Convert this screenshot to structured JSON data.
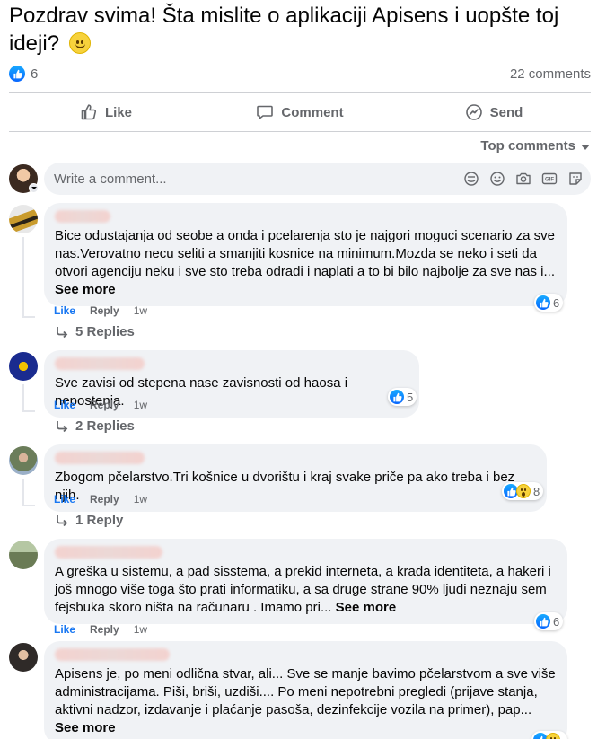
{
  "post": {
    "title": "Pozdrav svima! Šta mislite o aplikaciji Apisens i uopšte toj ideji?",
    "title_emoji": "slightly-smiling-face-icon",
    "like_count": "6",
    "comments_label": "22 comments"
  },
  "actions": {
    "like": "Like",
    "comment": "Comment",
    "send": "Send"
  },
  "sort": {
    "label": "Top comments"
  },
  "composer": {
    "placeholder": "Write a comment..."
  },
  "comments": [
    {
      "text": "Bice odustajanja od seobe a onda i pcelarenja sto je najgori moguci scenario za sve nas.Verovatno necu seliti a smanjiti kosnice na minimum.Mozda se neko i seti da otvori agenciju neku i sve sto treba odradi i naplati a to bi bilo najbolje za sve nas i...",
      "see_more": "See more",
      "reactions": "6",
      "like": "Like",
      "reply": "Reply",
      "time": "1w",
      "replies": "5 Replies"
    },
    {
      "text": "Sve zavisi od stepena nase zavisnosti od haosa i nepostenja.",
      "reactions": "5",
      "like": "Like",
      "reply": "Reply",
      "time": "1w",
      "replies": "2 Replies"
    },
    {
      "text": "Zbogom pčelarstvo.Tri košnice u dvorištu i kraj svake priče pa ako treba i bez njih.",
      "reactions": "8",
      "like": "Like",
      "reply": "Reply",
      "time": "1w",
      "replies": "1 Reply"
    },
    {
      "text": "A greška u sistemu, a pad sisstema, a prekid interneta, a krađa identiteta, a hakeri i još mnogo više toga što prati informatiku, a sa druge strane 90% ljudi neznaju sem fejsbuka skoro ništa na računaru . Imamo pri...",
      "see_more": "See more",
      "reactions": "6",
      "like": "Like",
      "reply": "Reply",
      "time": "1w"
    },
    {
      "text": "Apisens je, po meni odlična stvar, ali... Sve se manje bavimo pčelarstvom a sve više administracijama. Piši, briši, uzdiši.... Po meni nepotrebni pregledi (prijave stanja, aktivni nadzor, izdavanje i plaćanje pasoša, dezinfekcije vozila na primer), pap...",
      "see_more": "See more"
    }
  ],
  "colors": {
    "accent": "#1877f2",
    "bubble": "#f0f2f5",
    "secondary_text": "#65676b"
  }
}
